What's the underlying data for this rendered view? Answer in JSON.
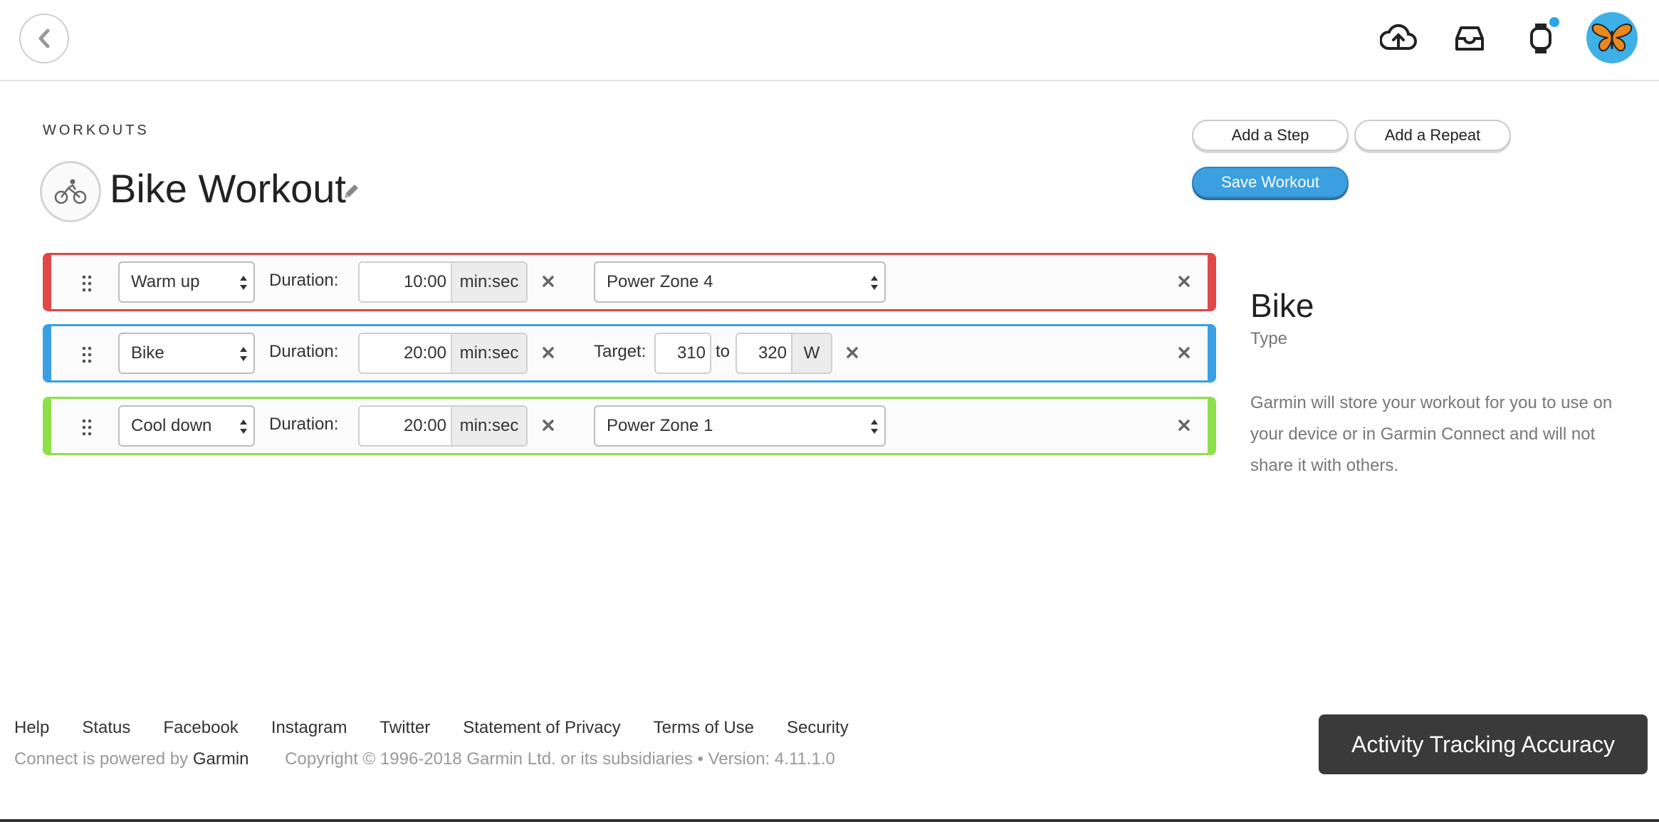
{
  "header": {
    "icons": [
      "chevron-left-icon",
      "upload-cloud-icon",
      "inbox-icon",
      "watch-icon",
      "avatar-butterfly"
    ]
  },
  "page": {
    "section_label": "WORKOUTS",
    "title": "Bike Workout"
  },
  "actions": {
    "add_step": "Add a Step",
    "add_repeat": "Add a Repeat",
    "save": "Save Workout"
  },
  "steps": [
    {
      "type": "Warm up",
      "duration_label": "Duration:",
      "duration_value": "10:00",
      "duration_unit": "min:sec",
      "target": "Power Zone 4",
      "color": "#e04848"
    },
    {
      "type": "Bike",
      "duration_label": "Duration:",
      "duration_value": "20:00",
      "duration_unit": "min:sec",
      "target_label": "Target:",
      "target_from": "310",
      "target_to_label": "to",
      "target_to": "320",
      "target_unit": "W",
      "color": "#3aa0e6"
    },
    {
      "type": "Cool down",
      "duration_label": "Duration:",
      "duration_value": "20:00",
      "duration_unit": "min:sec",
      "target": "Power Zone 1",
      "color": "#8ee04a"
    }
  ],
  "info": {
    "title": "Bike",
    "subtitle": "Type",
    "text": "Garmin will store your workout for you to use on your device or in Garmin Connect and will not share it with others."
  },
  "footer": {
    "links": [
      "Help",
      "Status",
      "Facebook",
      "Instagram",
      "Twitter",
      "Statement of Privacy",
      "Terms of Use",
      "Security"
    ],
    "powered_prefix": "Connect is powered by",
    "powered_brand": "Garmin",
    "copyright": "Copyright © 1996-2018 Garmin Ltd. or its subsidiaries • Version: 4.11.1.0",
    "accuracy_button": "Activity Tracking Accuracy"
  }
}
